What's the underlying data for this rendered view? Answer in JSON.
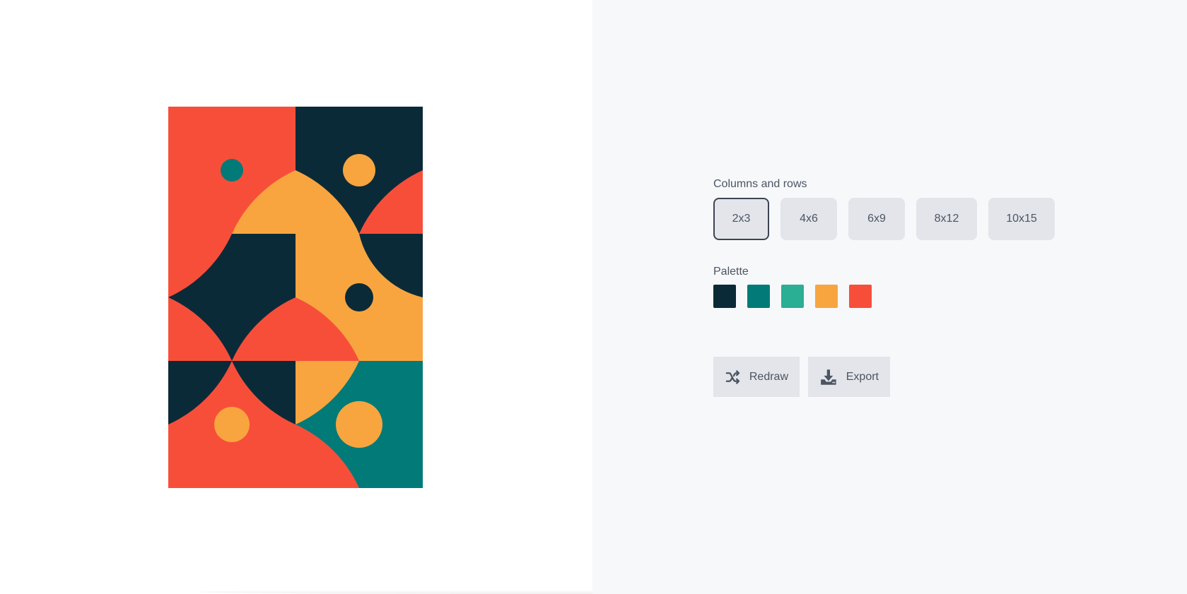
{
  "controls": {
    "grid_label": "Columns and rows",
    "grid_options": [
      "2x3",
      "4x6",
      "6x9",
      "8x12",
      "10x15"
    ],
    "selected_grid": "2x3",
    "palette_label": "Palette",
    "palette": [
      "#0b2a38",
      "#017a78",
      "#2aae94",
      "#f8a53f",
      "#f74e3a"
    ],
    "redraw_label": "Redraw",
    "export_label": "Export",
    "icons": {
      "redraw": "shuffle-icon",
      "export": "download-icon"
    }
  },
  "artwork": {
    "columns": 2,
    "rows": 3,
    "colors": {
      "navy": "#0b2a38",
      "teal": "#017a78",
      "green": "#2aae94",
      "orange": "#f8a53f",
      "red": "#f74e3a"
    }
  }
}
